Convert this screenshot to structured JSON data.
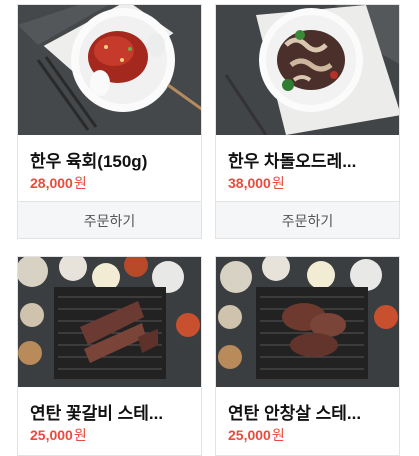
{
  "products": [
    {
      "name": "한우 육회(150g)",
      "price": "28,000",
      "currency": "원",
      "order_label": "주문하기",
      "image": "beef-tartare-plate"
    },
    {
      "name": "한우 차돌오드레...",
      "price": "38,000",
      "currency": "원",
      "order_label": "주문하기",
      "image": "brisket-stirfry-plate"
    },
    {
      "name": "연탄 꽃갈비 스테...",
      "price": "25,000",
      "currency": "원",
      "image": "grilled-rib-steak-set"
    },
    {
      "name": "연탄 안창살 스테...",
      "price": "25,000",
      "currency": "원",
      "image": "grilled-skirt-steak-set"
    }
  ],
  "colors": {
    "price": "#e94b3c",
    "button_bg": "#f5f6f8",
    "border": "#e3e3e3"
  }
}
